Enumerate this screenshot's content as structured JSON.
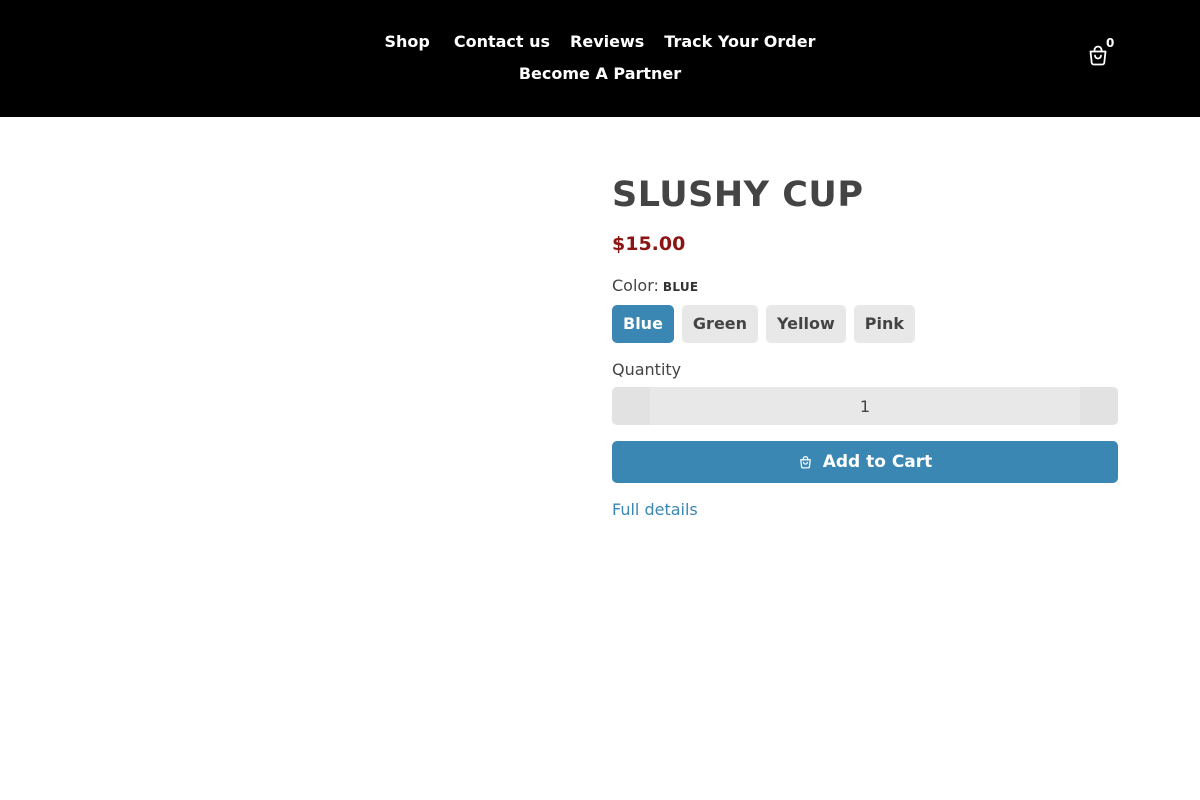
{
  "header": {
    "nav": {
      "shop": "Shop",
      "contact": "Contact us",
      "reviews": "Reviews",
      "track": "Track Your Order",
      "partner": "Become A Partner"
    },
    "cart": {
      "icon": "shopping-bag-icon",
      "count": "0"
    }
  },
  "product": {
    "title": "SLUSHY CUP",
    "price": "$15.00",
    "color_label": "Color:",
    "color_value": "BLUE",
    "colors": [
      "Blue",
      "Green",
      "Yellow",
      "Pink"
    ],
    "selected_color": "Blue",
    "quantity_label": "Quantity",
    "quantity_value": "1",
    "add_to_cart": "Add to Cart",
    "full_details": "Full details"
  },
  "colors": {
    "header_bg": "#000000",
    "accent": "#3a87b3",
    "price": "#8b1414",
    "swatch_bg": "#e8e8e8"
  }
}
